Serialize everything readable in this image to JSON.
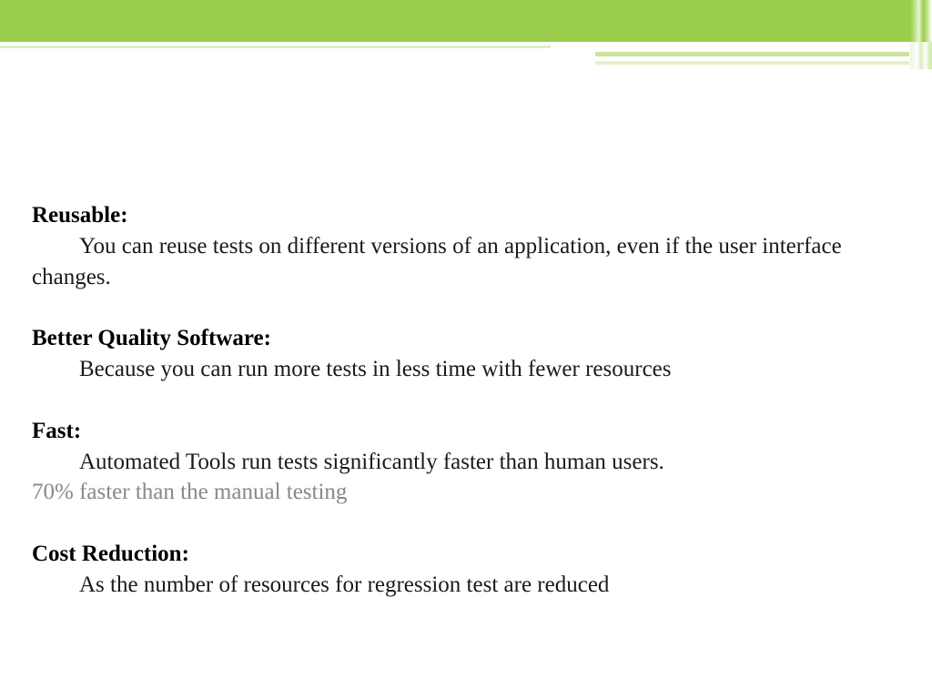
{
  "header": {
    "accent_color": "#9ACD4C"
  },
  "sections": {
    "reusable": {
      "heading": "Reusable:",
      "body": "You can reuse tests on different versions of an application, even if the user interface changes."
    },
    "quality": {
      "heading": "Better Quality Software:",
      "body": "Because you can run more tests in less time with fewer resources"
    },
    "fast": {
      "heading": "Fast:",
      "body": "Automated Tools run tests significantly faster than human users.",
      "note": "70% faster than the manual testing"
    },
    "cost": {
      "heading": "Cost Reduction:",
      "body": "As the number of resources for regression test are reduced"
    }
  }
}
